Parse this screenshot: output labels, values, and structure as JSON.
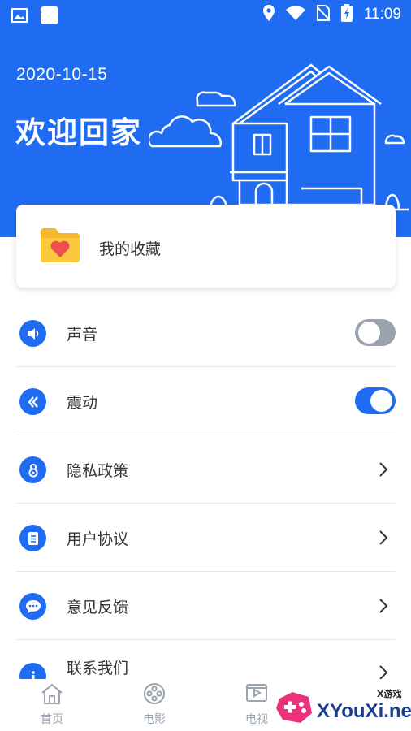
{
  "status_bar": {
    "time": "11:09",
    "left_icons": [
      "gallery-icon",
      "app-square-icon"
    ],
    "right_icons": [
      "location-icon",
      "wifi-icon",
      "no-sim-icon",
      "battery-charging-icon"
    ]
  },
  "header": {
    "date": "2020-10-15",
    "title": "欢迎回家",
    "background_color": "#1f6cf2"
  },
  "favorites_card": {
    "label": "我的收藏",
    "icon": "heart-folder-icon"
  },
  "settings": [
    {
      "id": "sound",
      "label": "声音",
      "icon": "speaker-icon",
      "control": "toggle",
      "on": false
    },
    {
      "id": "vibrate",
      "label": "震动",
      "icon": "vibration-icon",
      "control": "toggle",
      "on": true
    },
    {
      "id": "privacy",
      "label": "隐私政策",
      "icon": "lock-icon",
      "control": "chevron"
    },
    {
      "id": "agreement",
      "label": "用户协议",
      "icon": "document-icon",
      "control": "chevron"
    },
    {
      "id": "feedback",
      "label": "意见反馈",
      "icon": "chat-bubble-icon",
      "control": "chevron"
    },
    {
      "id": "contact",
      "label": "联系我们",
      "icon": "info-icon",
      "control": "chevron"
    }
  ],
  "tab_bar": [
    {
      "label": "首页",
      "icon": "home-icon"
    },
    {
      "label": "电影",
      "icon": "film-reel-icon"
    },
    {
      "label": "电视",
      "icon": "tv-icon"
    }
  ],
  "watermark": {
    "small": "X游戏",
    "text": "XYouXi.net"
  },
  "colors": {
    "accent": "#1f6cf2",
    "toggle_off": "#9aa2ad",
    "tab_inactive": "#9aa2ad"
  }
}
